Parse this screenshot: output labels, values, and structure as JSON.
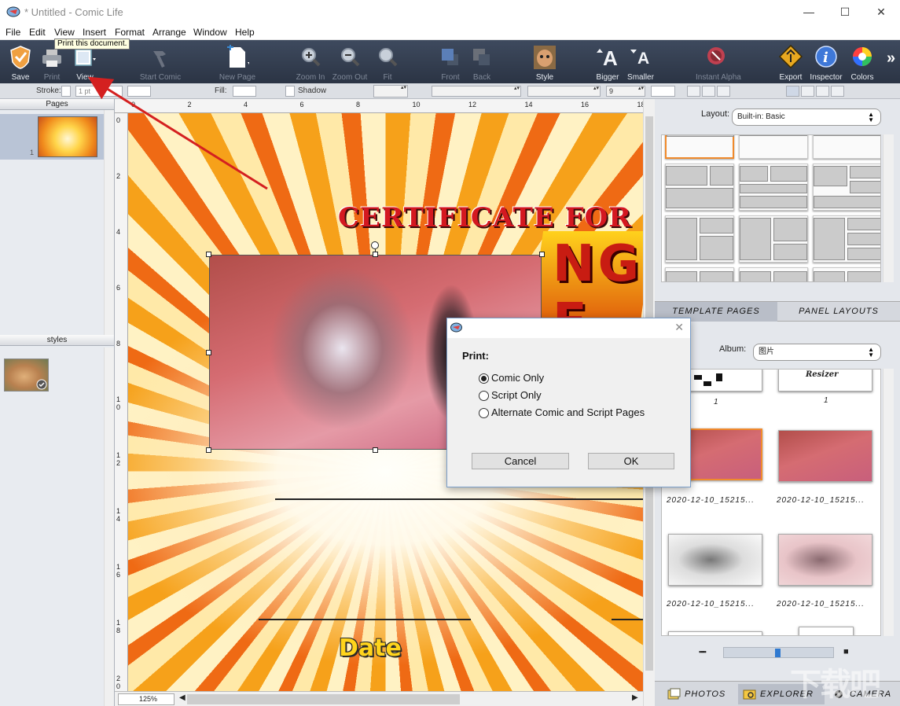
{
  "window": {
    "title": "* Untitled - Comic Life",
    "minimize": "—",
    "maximize": "☐",
    "close": "✕"
  },
  "menu": [
    "File",
    "Edit",
    "View",
    "Insert",
    "Format",
    "Arrange",
    "Window",
    "Help"
  ],
  "tooltip": "Print this document.",
  "toolbar": {
    "save": "Save",
    "print": "Print",
    "view": "View",
    "start_comic": "Start Comic",
    "new_page": "New Page",
    "zoom_in": "Zoom In",
    "zoom_out": "Zoom Out",
    "fit": "Fit",
    "front": "Front",
    "back": "Back",
    "style": "Style",
    "bigger": "Bigger",
    "smaller": "Smaller",
    "instant_alpha": "Instant Alpha",
    "export": "Export",
    "inspector": "Inspector",
    "colors": "Colors",
    "more": "»"
  },
  "formatbar": {
    "stroke_label": "Stroke:",
    "stroke_width": "1 pt",
    "fill_label": "Fill:",
    "shadow_label": "Shadow",
    "font_size": "9"
  },
  "left": {
    "pages_header": "Pages",
    "page_number": "1",
    "styles_header": "styles"
  },
  "rulers": {
    "top": [
      "0",
      "2",
      "4",
      "6",
      "8",
      "10",
      "12",
      "14",
      "16",
      "18"
    ],
    "left": [
      "0",
      "2",
      "4",
      "6",
      "8",
      "1\n0",
      "1\n2",
      "1\n4",
      "1\n6",
      "1\n8",
      "2\n0"
    ]
  },
  "canvas": {
    "certificate_text": "CERTIFICATE FOR",
    "banner_text": "NG E",
    "date_text": "Date"
  },
  "zoom": "125%",
  "right": {
    "layout_label": "Layout:",
    "layout_value": "Built-in: Basic",
    "tab_template": "TEMPLATE PAGES",
    "tab_panel": "PANEL LAYOUTS",
    "album_label": "Album:",
    "album_value": "图片",
    "photo_captions": [
      "1",
      "1",
      "2020-12-10_15215...",
      "2020-12-10_15215...",
      "2020-12-10_15215...",
      "2020-12-10_15215..."
    ],
    "top_thumb_text": "Resizer",
    "bottom_tabs": [
      "PHOTOS",
      "EXPLORER",
      "CAMERA"
    ]
  },
  "dialog": {
    "title": "Print:",
    "options": [
      "Comic Only",
      "Script Only",
      "Alternate Comic and Script Pages"
    ],
    "selected": 0,
    "cancel": "Cancel",
    "ok": "OK"
  },
  "watermark": "下载吧",
  "colors": {
    "toolbar_bg": "#2b3444",
    "selection_orange": "#f08a2c",
    "arrow_red": "#d42020",
    "cert_red": "#d41820"
  }
}
